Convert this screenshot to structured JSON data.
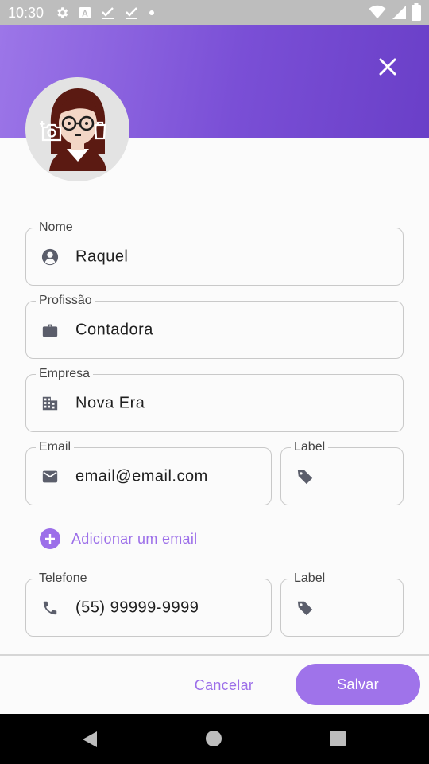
{
  "status_bar": {
    "time": "10:30",
    "icons_left": [
      "gear-icon",
      "a-box-icon",
      "check-download-icon",
      "check-download-icon",
      "dot-icon"
    ],
    "icons_right": [
      "wifi-icon",
      "signal-icon",
      "battery-icon"
    ]
  },
  "header": {
    "gradient_start": "#9c76e8",
    "gradient_end": "#6a3fc8",
    "close_icon": "close-icon"
  },
  "form": {
    "name": {
      "label": "Nome",
      "value": "Raquel",
      "icon": "account-circle-icon"
    },
    "profession": {
      "label": "Profissão",
      "value": "Contadora",
      "icon": "briefcase-icon"
    },
    "company": {
      "label": "Empresa",
      "value": "Nova Era",
      "icon": "building-icon"
    },
    "email": {
      "label": "Email",
      "value": "email@email.com",
      "icon": "mail-icon"
    },
    "email_tag": {
      "label": "Label",
      "value": "",
      "icon": "tag-icon"
    },
    "add_email": {
      "label": "Adicionar um email",
      "icon": "add-circle-icon"
    },
    "phone": {
      "label": "Telefone",
      "value": "(55) 99999-9999",
      "icon": "phone-icon"
    },
    "phone_tag": {
      "label": "Label",
      "value": "",
      "icon": "tag-icon"
    }
  },
  "actions": {
    "cancel_label": "Cancelar",
    "save_label": "Salvar",
    "accent_color": "#9f73ea"
  }
}
